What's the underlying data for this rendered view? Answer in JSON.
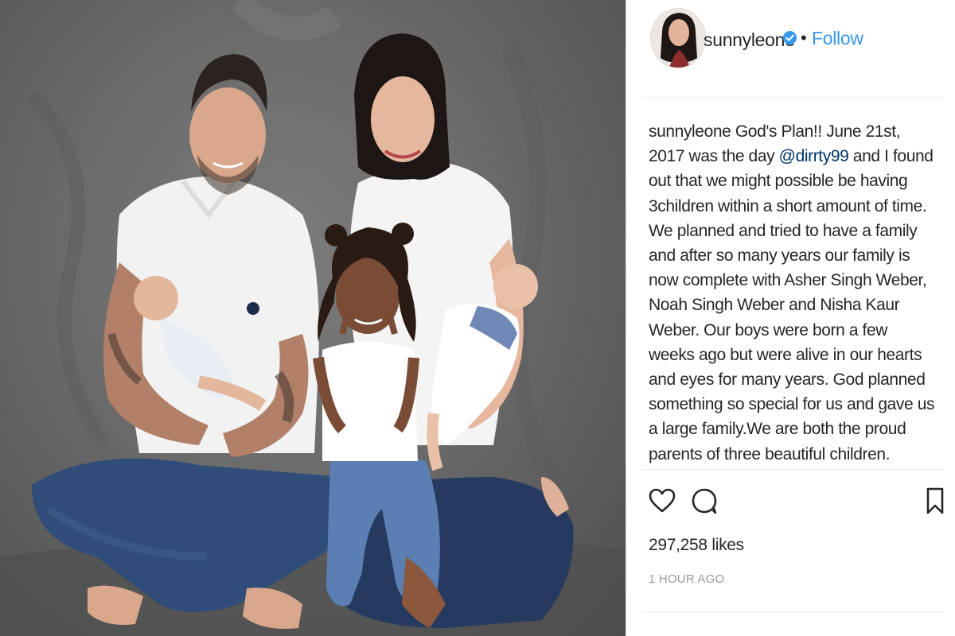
{
  "post": {
    "author": {
      "username": "sunnyleone",
      "verified": true,
      "separator": "•",
      "follow_label": "Follow"
    },
    "caption": {
      "username": "sunnyleone",
      "text_before_mention": "God's Plan!! June 21st, 2017 was the day",
      "mention": "@dirrty99",
      "text_after_mention": "and I found out that we might possible be having 3children within a short amount of time. We planned and tried to have a family and after so many years our family is now complete with Asher Singh Weber, Noah Singh Weber and Nisha Kaur Weber. Our boys were born a few weeks ago but were alive in our hearts and eyes for many years. God planned something so special for us and gave us a large family.We are both the proud parents of three beautiful children."
    },
    "actions": {
      "like_icon": "heart-outline-icon",
      "comment_icon": "comment-bubble-icon",
      "save_icon": "bookmark-outline-icon"
    },
    "likes_label": "297,258 likes",
    "timestamp": "1 HOUR AGO"
  },
  "colors": {
    "link": "#3897f0",
    "mention": "#003569",
    "verified_badge": "#3897f0",
    "muted": "#999999",
    "text": "#262626"
  }
}
